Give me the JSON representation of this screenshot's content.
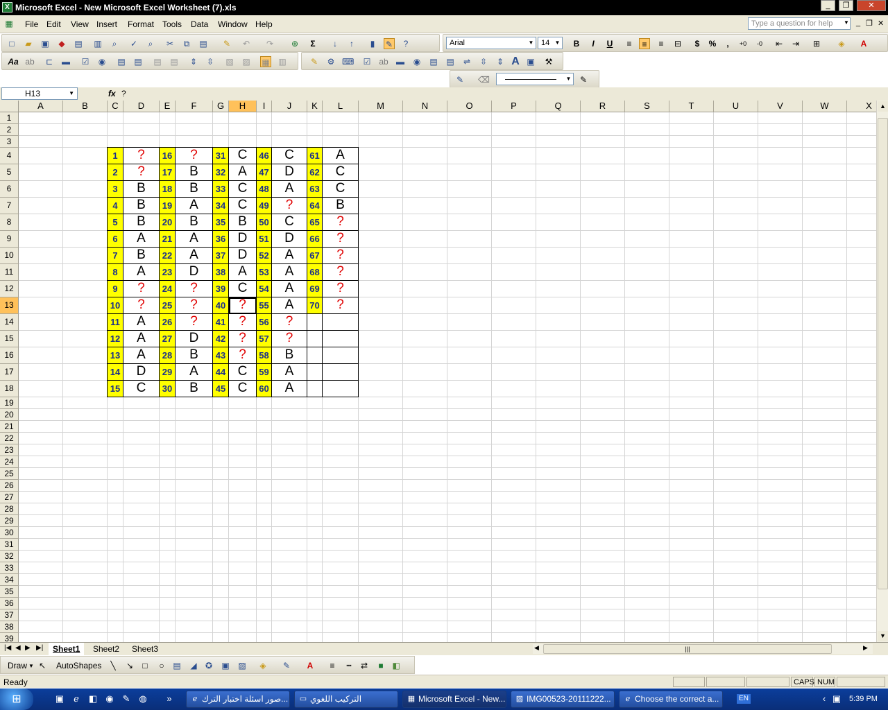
{
  "window": {
    "title": "Microsoft Excel - New Microsoft Excel Worksheet (7).xls",
    "app_icon": "X"
  },
  "menus": [
    "File",
    "Edit",
    "View",
    "Insert",
    "Format",
    "Tools",
    "Data",
    "Window",
    "Help"
  ],
  "help_box_placeholder": "Type a question for help",
  "font": {
    "name": "Arial",
    "size": "14"
  },
  "formula_bar": {
    "name_box": "H13",
    "fx": "fx",
    "value": "?"
  },
  "columns": [
    "A",
    "B",
    "C",
    "D",
    "E",
    "F",
    "G",
    "H",
    "I",
    "J",
    "K",
    "L",
    "M",
    "N",
    "O",
    "P",
    "Q",
    "R",
    "S",
    "T",
    "U",
    "V",
    "W",
    "X"
  ],
  "rows": [
    "1",
    "2",
    "3",
    "4",
    "5",
    "6",
    "7",
    "8",
    "9",
    "10",
    "11",
    "12",
    "13",
    "14",
    "15",
    "16",
    "17",
    "18",
    "19",
    "20",
    "21",
    "22",
    "23",
    "24",
    "25",
    "26",
    "27",
    "28",
    "29",
    "30",
    "31",
    "32",
    "33",
    "34",
    "35",
    "36",
    "37",
    "38",
    "39"
  ],
  "selected": {
    "column": "H",
    "row": "13"
  },
  "answer_table": [
    [
      "1",
      "?",
      "16",
      "?",
      "31",
      "C",
      "46",
      "C",
      "61",
      "A"
    ],
    [
      "2",
      "?",
      "17",
      "B",
      "32",
      "A",
      "47",
      "D",
      "62",
      "C"
    ],
    [
      "3",
      "B",
      "18",
      "B",
      "33",
      "C",
      "48",
      "A",
      "63",
      "C"
    ],
    [
      "4",
      "B",
      "19",
      "A",
      "34",
      "C",
      "49",
      "?",
      "64",
      "B"
    ],
    [
      "5",
      "B",
      "20",
      "B",
      "35",
      "B",
      "50",
      "C",
      "65",
      "?"
    ],
    [
      "6",
      "A",
      "21",
      "A",
      "36",
      "D",
      "51",
      "D",
      "66",
      "?"
    ],
    [
      "7",
      "B",
      "22",
      "A",
      "37",
      "D",
      "52",
      "A",
      "67",
      "?"
    ],
    [
      "8",
      "A",
      "23",
      "D",
      "38",
      "A",
      "53",
      "A",
      "68",
      "?"
    ],
    [
      "9",
      "?",
      "24",
      "?",
      "39",
      "C",
      "54",
      "A",
      "69",
      "?"
    ],
    [
      "10",
      "?",
      "25",
      "?",
      "40",
      "?",
      "55",
      "A",
      "70",
      "?"
    ],
    [
      "11",
      "A",
      "26",
      "?",
      "41",
      "?",
      "56",
      "?",
      "",
      ""
    ],
    [
      "12",
      "A",
      "27",
      "D",
      "42",
      "?",
      "57",
      "?",
      "",
      ""
    ],
    [
      "13",
      "A",
      "28",
      "B",
      "43",
      "?",
      "58",
      "B",
      "",
      ""
    ],
    [
      "14",
      "D",
      "29",
      "A",
      "44",
      "C",
      "59",
      "A",
      "",
      ""
    ],
    [
      "15",
      "C",
      "30",
      "B",
      "45",
      "C",
      "60",
      "A",
      "",
      ""
    ]
  ],
  "sheets": [
    "Sheet1",
    "Sheet2",
    "Sheet3"
  ],
  "active_sheet": "Sheet1",
  "draw_toolbar": {
    "draw": "Draw",
    "autoshapes": "AutoShapes"
  },
  "status": {
    "text": "Ready",
    "caps": "CAPS",
    "num": "NUM"
  },
  "taskbar": {
    "tasks": [
      "صور اسئلة اختبار الترك...",
      "التركيب اللغوي",
      "Microsoft Excel - New...",
      "IMG00523-20111222...",
      "Choose the correct a..."
    ],
    "active_task": "Microsoft Excel - New...",
    "language": "EN",
    "clock": "5:39 PM"
  }
}
